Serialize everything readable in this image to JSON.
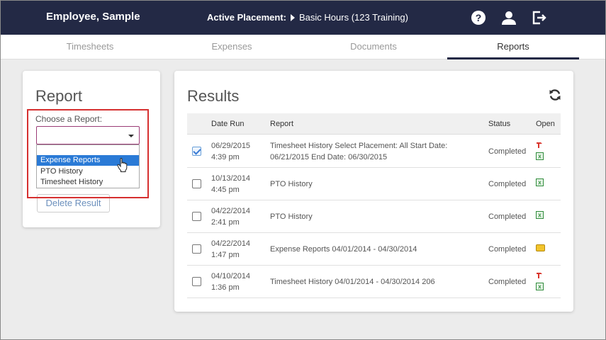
{
  "header": {
    "user_name": "Employee, Sample",
    "placement_label": "Active Placement:",
    "placement_value": "Basic Hours (123 Training)"
  },
  "tabs": [
    {
      "label": "Timesheets",
      "active": false
    },
    {
      "label": "Expenses",
      "active": false
    },
    {
      "label": "Documents",
      "active": false
    },
    {
      "label": "Reports",
      "active": true
    }
  ],
  "report_panel": {
    "title": "Report",
    "choose_label": "Choose a Report:",
    "selected_value": "",
    "options": [
      "Expense Reports",
      "PTO History",
      "Timesheet History"
    ],
    "highlighted_option": "Expense Reports",
    "delete_button": "Delete Result"
  },
  "results": {
    "title": "Results",
    "columns": [
      "Date Run",
      "Report",
      "Status",
      "Open"
    ],
    "rows": [
      {
        "checked": true,
        "date": "06/29/2015",
        "time": "4:39 pm",
        "report_line1": "Timesheet History Select Placement: All Start Date:",
        "report_line2": "06/21/2015 End Date: 06/30/2015",
        "status": "Completed",
        "icons": [
          "pdf",
          "excel"
        ]
      },
      {
        "checked": false,
        "date": "10/13/2014",
        "time": "4:45 pm",
        "report_line1": "PTO History",
        "report_line2": "",
        "status": "Completed",
        "icons": [
          "excel"
        ]
      },
      {
        "checked": false,
        "date": "04/22/2014",
        "time": "2:41 pm",
        "report_line1": "PTO History",
        "report_line2": "",
        "status": "Completed",
        "icons": [
          "excel"
        ]
      },
      {
        "checked": false,
        "date": "04/22/2014",
        "time": "1:47 pm",
        "report_line1": "Expense Reports 04/01/2014 - 04/30/2014",
        "report_line2": "",
        "status": "Completed",
        "icons": [
          "folder"
        ]
      },
      {
        "checked": false,
        "date": "04/10/2014",
        "time": "1:36 pm",
        "report_line1": "Timesheet History 04/01/2014 - 04/30/2014 206",
        "report_line2": "",
        "status": "Completed",
        "icons": [
          "pdf",
          "excel"
        ]
      }
    ]
  },
  "colors": {
    "header_bg": "#232945",
    "accent_blue": "#2a7ad6",
    "highlight_red": "#d63030"
  }
}
